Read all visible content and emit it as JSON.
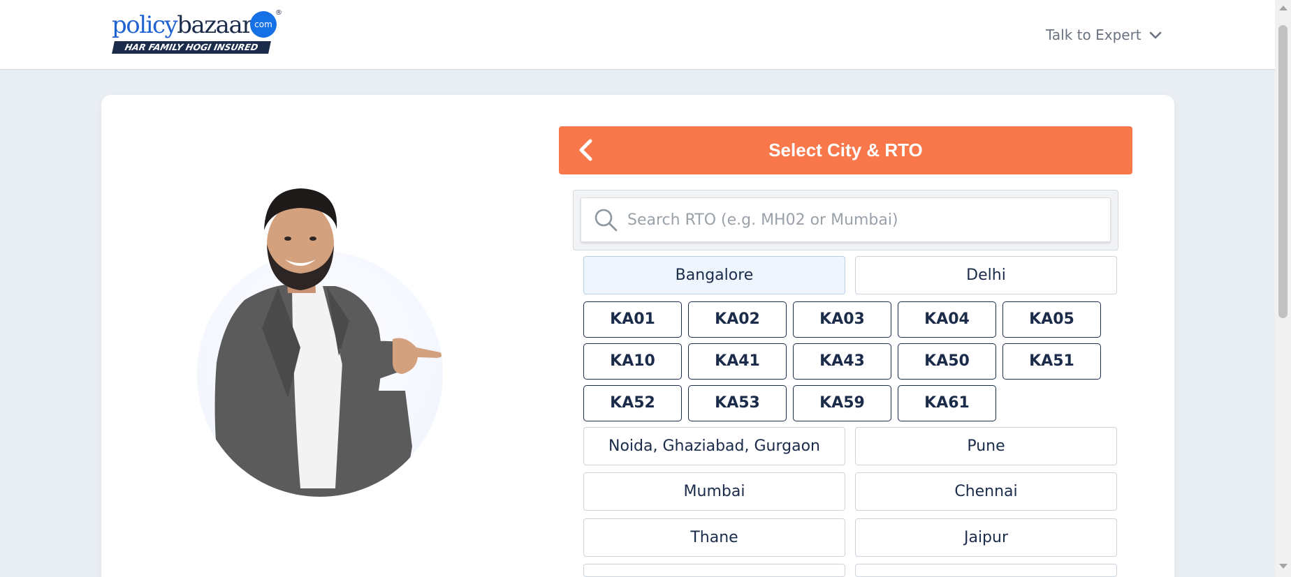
{
  "header": {
    "logo": {
      "policy": "policy",
      "bazaar": "bazaar",
      "com": "com",
      "reg": "®",
      "tagline": "HAR FAMILY HOGI INSURED"
    },
    "talk_label": "Talk to Expert"
  },
  "panel": {
    "title": "Select City & RTO",
    "search_placeholder": "Search RTO (e.g. MH02 or Mumbai)",
    "cities": [
      {
        "label": "Bangalore",
        "selected": true
      },
      {
        "label": "Delhi",
        "selected": false
      },
      {
        "label": "Noida, Ghaziabad, Gurgaon",
        "selected": false
      },
      {
        "label": "Pune",
        "selected": false
      },
      {
        "label": "Mumbai",
        "selected": false
      },
      {
        "label": "Chennai",
        "selected": false
      },
      {
        "label": "Thane",
        "selected": false
      },
      {
        "label": "Jaipur",
        "selected": false
      }
    ],
    "rtos": [
      "KA01",
      "KA02",
      "KA03",
      "KA04",
      "KA05",
      "KA10",
      "KA41",
      "KA43",
      "KA50",
      "KA51",
      "KA52",
      "KA53",
      "KA59",
      "KA61"
    ]
  },
  "colors": {
    "accent": "#f8774b",
    "brand_navy": "#1b2b4a",
    "brand_blue": "#1f62d1"
  },
  "icons": {
    "back": "chevron-left-icon",
    "search": "search-icon",
    "dropdown": "chevron-down-icon"
  }
}
